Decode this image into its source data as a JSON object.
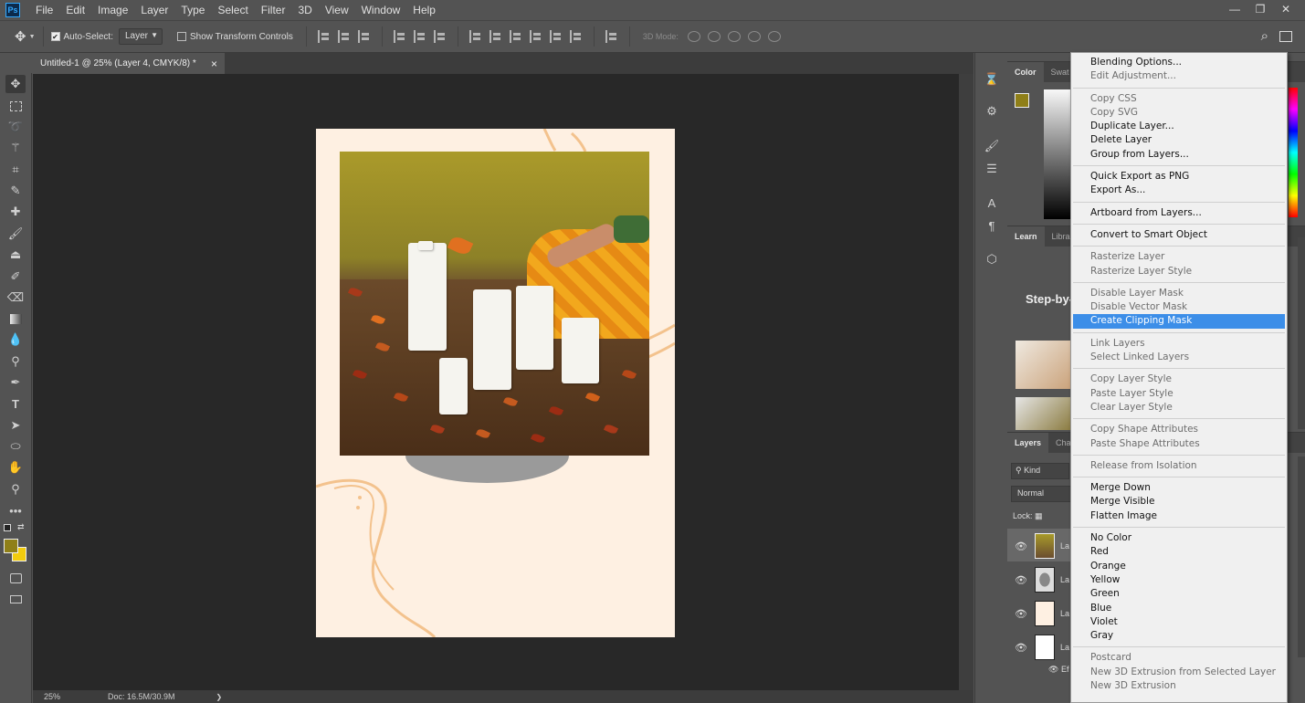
{
  "app": {
    "logo_text": "Ps"
  },
  "menubar": {
    "items": [
      "File",
      "Edit",
      "Image",
      "Layer",
      "Type",
      "Select",
      "Filter",
      "3D",
      "View",
      "Window",
      "Help"
    ]
  },
  "window_controls": {
    "minimize": "—",
    "restore": "❐",
    "close": "✕"
  },
  "options_bar": {
    "auto_select_label": "Auto-Select:",
    "auto_select_checked": true,
    "target_dropdown": "Layer",
    "show_transform_label": "Show Transform Controls",
    "show_transform_checked": false,
    "mode_3d_label": "3D Mode:"
  },
  "document_tab": {
    "title": "Untitled-1 @ 25% (Layer 4, CMYK/8) *",
    "close": "×"
  },
  "status_bar": {
    "zoom": "25%",
    "doc": "Doc: 16.5M/30.9M",
    "arrow": "❯"
  },
  "colors": {
    "foreground": "#8f7f18",
    "background": "#f2cc0e",
    "highlight": "#3c8ee8"
  },
  "panels": {
    "color": {
      "tabs": [
        "Color",
        "Swat"
      ]
    },
    "learn": {
      "tabs": [
        "Learn",
        "Libra"
      ],
      "heading": "Step-by-"
    },
    "layers": {
      "tabs": [
        "Layers",
        "Cha"
      ],
      "filter_label": "Kind",
      "blend_mode": "Normal",
      "lock_label": "Lock:",
      "rows": [
        {
          "eye": "👁",
          "name": "La"
        },
        {
          "eye": "👁",
          "name": "La"
        },
        {
          "eye": "👁",
          "name": "La"
        },
        {
          "eye": "👁",
          "name": "La"
        }
      ],
      "effects_label": "Ef"
    }
  },
  "context_menu": {
    "groups": [
      [
        {
          "label": "Blending Options...",
          "enabled": true
        },
        {
          "label": "Edit Adjustment...",
          "enabled": false
        }
      ],
      [
        {
          "label": "Copy CSS",
          "enabled": false
        },
        {
          "label": "Copy SVG",
          "enabled": false
        },
        {
          "label": "Duplicate Layer...",
          "enabled": true
        },
        {
          "label": "Delete Layer",
          "enabled": true
        },
        {
          "label": "Group from Layers...",
          "enabled": true
        }
      ],
      [
        {
          "label": "Quick Export as PNG",
          "enabled": true
        },
        {
          "label": "Export As...",
          "enabled": true
        }
      ],
      [
        {
          "label": "Artboard from Layers...",
          "enabled": true
        }
      ],
      [
        {
          "label": "Convert to Smart Object",
          "enabled": true
        }
      ],
      [
        {
          "label": "Rasterize Layer",
          "enabled": false
        },
        {
          "label": "Rasterize Layer Style",
          "enabled": false
        }
      ],
      [
        {
          "label": "Disable Layer Mask",
          "enabled": false
        },
        {
          "label": "Disable Vector Mask",
          "enabled": false
        },
        {
          "label": "Create Clipping Mask",
          "enabled": true,
          "highlighted": true
        }
      ],
      [
        {
          "label": "Link Layers",
          "enabled": false
        },
        {
          "label": "Select Linked Layers",
          "enabled": false
        }
      ],
      [
        {
          "label": "Copy Layer Style",
          "enabled": false
        },
        {
          "label": "Paste Layer Style",
          "enabled": false
        },
        {
          "label": "Clear Layer Style",
          "enabled": false
        }
      ],
      [
        {
          "label": "Copy Shape Attributes",
          "enabled": false
        },
        {
          "label": "Paste Shape Attributes",
          "enabled": false
        }
      ],
      [
        {
          "label": "Release from Isolation",
          "enabled": false
        }
      ],
      [
        {
          "label": "Merge Down",
          "enabled": true
        },
        {
          "label": "Merge Visible",
          "enabled": true
        },
        {
          "label": "Flatten Image",
          "enabled": true
        }
      ],
      [
        {
          "label": "No Color",
          "enabled": true
        },
        {
          "label": "Red",
          "enabled": true
        },
        {
          "label": "Orange",
          "enabled": true
        },
        {
          "label": "Yellow",
          "enabled": true
        },
        {
          "label": "Green",
          "enabled": true
        },
        {
          "label": "Blue",
          "enabled": true
        },
        {
          "label": "Violet",
          "enabled": true
        },
        {
          "label": "Gray",
          "enabled": true
        }
      ],
      [
        {
          "label": "Postcard",
          "enabled": false
        },
        {
          "label": "New 3D Extrusion from Selected Layer",
          "enabled": false
        },
        {
          "label": "New 3D Extrusion",
          "enabled": false
        }
      ]
    ]
  },
  "tools": [
    "move-icon",
    "marquee-icon",
    "lasso-icon",
    "magic-wand-icon",
    "crop-icon",
    "eyedropper-icon",
    "healing-brush-icon",
    "brush-icon",
    "clone-stamp-icon",
    "history-brush-icon",
    "eraser-icon",
    "gradient-icon",
    "blur-icon",
    "dodge-icon",
    "pen-icon",
    "type-icon",
    "path-selection-icon",
    "ellipse-icon",
    "hand-icon",
    "zoom-icon",
    "more-tools-icon"
  ]
}
